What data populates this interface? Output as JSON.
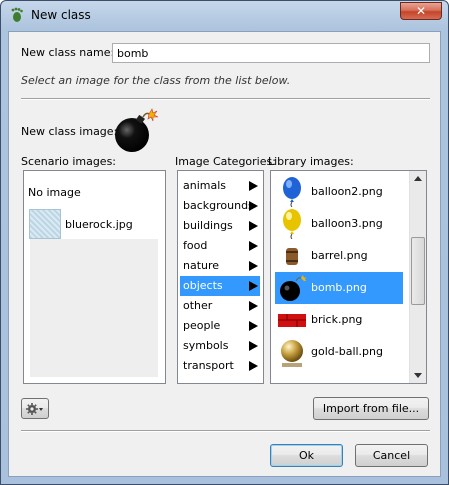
{
  "window": {
    "title": "New class",
    "close_glyph": "✕"
  },
  "form": {
    "name_label": "New class name:",
    "name_value": "bomb",
    "hint": "Select an image for the class from the list below.",
    "image_label": "New class image:"
  },
  "scenario": {
    "label": "Scenario images:",
    "items": [
      "No image",
      "bluerock.jpg"
    ]
  },
  "categories": {
    "label": "Image Categories:",
    "items": [
      "animals",
      "backgrounds",
      "buildings",
      "food",
      "nature",
      "objects",
      "other",
      "people",
      "symbols",
      "transport"
    ],
    "selected": "objects"
  },
  "library": {
    "label": "Library images:",
    "items": [
      {
        "name": "balloon2.png",
        "icon": "blue-balloon-icon"
      },
      {
        "name": "balloon3.png",
        "icon": "yellow-balloon-icon"
      },
      {
        "name": "barrel.png",
        "icon": "barrel-icon"
      },
      {
        "name": "bomb.png",
        "icon": "bomb-icon"
      },
      {
        "name": "brick.png",
        "icon": "red-brick-icon"
      },
      {
        "name": "gold-ball.png",
        "icon": "gold-ball-icon"
      }
    ],
    "selected": "bomb.png"
  },
  "buttons": {
    "import": "Import from file...",
    "ok": "Ok",
    "cancel": "Cancel"
  },
  "colors": {
    "selection": "#3399ff",
    "client_bg": "#f0f0f0"
  }
}
